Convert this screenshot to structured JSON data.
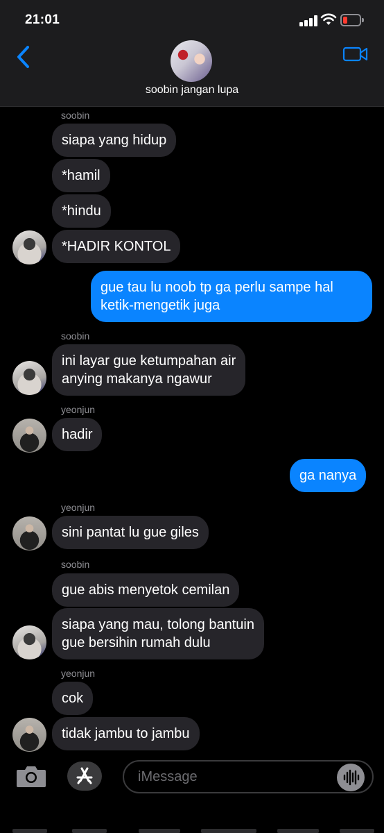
{
  "status": {
    "time": "21:01",
    "battery_color": "#ff3b30"
  },
  "header": {
    "contact_name": "soobin jangan lupa"
  },
  "senders": {
    "soobin": "soobin",
    "yeonjun": "yeonjun"
  },
  "messages": [
    "siapa yang hidup",
    "*hamil",
    "*hindu",
    "*HADIR KONTOL",
    "gue tau lu noob tp ga perlu sampe hal",
    "ketik-mengetik juga",
    "ini layar gue ketumpahan air",
    "anying makanya ngawur",
    "hadir",
    "ga nanya",
    "sini pantat lu gue giles",
    "gue abis menyetok cemilan",
    "siapa yang mau, tolong bantuin",
    "gue bersihin rumah dulu",
    "cok",
    "tidak jambu to jambu"
  ],
  "input": {
    "placeholder": "iMessage"
  },
  "colors": {
    "incoming_bubble": "#26252a",
    "outgoing_bubble": "#0a84ff",
    "accent": "#0a84ff"
  },
  "icons": [
    "back-chevron-icon",
    "video-camera-icon",
    "camera-icon",
    "app-store-icon",
    "audio-waveform-icon"
  ]
}
